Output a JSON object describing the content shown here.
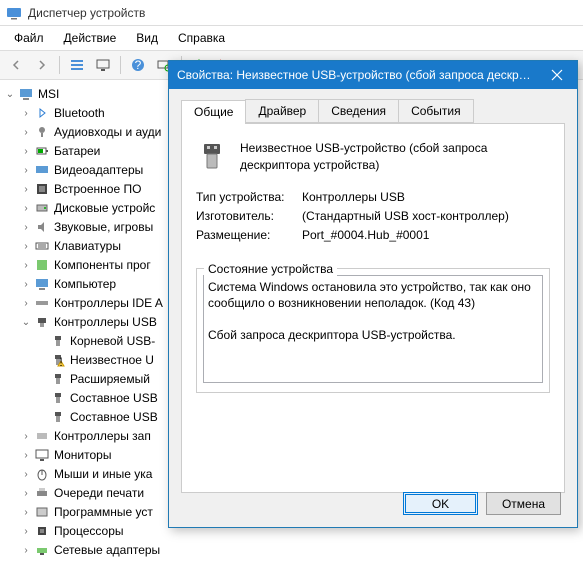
{
  "window": {
    "title": "Диспетчер устройств"
  },
  "menu": {
    "file": "Файл",
    "action": "Действие",
    "view": "Вид",
    "help": "Справка"
  },
  "tree": {
    "root": "MSI",
    "items": [
      "Bluetooth",
      "Аудиовходы и ауди",
      "Батареи",
      "Видеоадаптеры",
      "Встроенное ПО",
      "Дисковые устройс",
      "Звуковые, игровы",
      "Клавиатуры",
      "Компоненты прог",
      "Компьютер",
      "Контроллеры IDE A",
      "Контроллеры USB",
      "Контроллеры зап",
      "Мониторы",
      "Мыши и иные ука",
      "Очереди печати",
      "Программные уст",
      "Процессоры",
      "Сетевые адаптеры"
    ],
    "usb_children": [
      "Корневой USB-",
      "Неизвестное U",
      "Расширяемый",
      "Составное USB",
      "Составное USB"
    ]
  },
  "dialog": {
    "title": "Свойства: Неизвестное USB-устройство (сбой запроса дескрип...",
    "tabs": {
      "general": "Общие",
      "driver": "Драйвер",
      "details": "Сведения",
      "events": "События"
    },
    "device_name": "Неизвестное USB-устройство (сбой запроса дескриптора устройства)",
    "prop_type_k": "Тип устройства:",
    "prop_type_v": "Контроллеры USB",
    "prop_mfg_k": "Изготовитель:",
    "prop_mfg_v": "(Стандартный USB хост-контроллер)",
    "prop_loc_k": "Размещение:",
    "prop_loc_v": "Port_#0004.Hub_#0001",
    "status_legend": "Состояние устройства",
    "status_text": "Система Windows остановила это устройство, так как оно сообщило о возникновении неполадок. (Код 43)\n\nСбой запроса дескриптора USB-устройства.",
    "ok": "OK",
    "cancel": "Отмена"
  }
}
